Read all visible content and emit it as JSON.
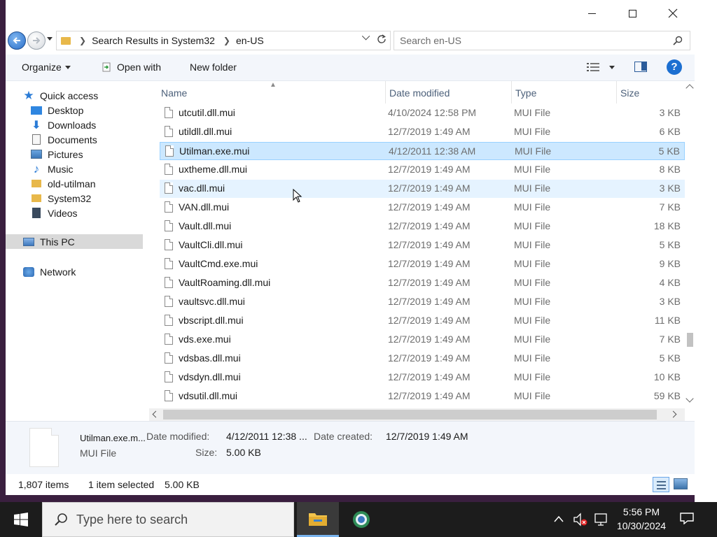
{
  "window": {
    "address": {
      "segments": [
        "Search Results in System32",
        "en-US"
      ]
    },
    "search": {
      "placeholder": "Search en-US"
    }
  },
  "toolbar": {
    "organize_label": "Organize",
    "open_with_label": "Open with",
    "new_folder_label": "New folder"
  },
  "nav": {
    "items": [
      {
        "label": "Quick access"
      },
      {
        "label": "Desktop"
      },
      {
        "label": "Downloads"
      },
      {
        "label": "Documents"
      },
      {
        "label": "Pictures"
      },
      {
        "label": "Music"
      },
      {
        "label": "old-utilman"
      },
      {
        "label": "System32"
      },
      {
        "label": "Videos"
      },
      {
        "label": "This PC"
      },
      {
        "label": "Network"
      }
    ]
  },
  "columns": {
    "name": "Name",
    "date": "Date modified",
    "type": "Type",
    "size": "Size"
  },
  "files": [
    {
      "name": "utcutil.dll.mui",
      "date": "4/10/2024 12:58 PM",
      "type": "MUI File",
      "size": "3 KB"
    },
    {
      "name": "utildll.dll.mui",
      "date": "12/7/2019 1:49 AM",
      "type": "MUI File",
      "size": "6 KB"
    },
    {
      "name": "Utilman.exe.mui",
      "date": "4/12/2011 12:38 AM",
      "type": "MUI File",
      "size": "5 KB"
    },
    {
      "name": "uxtheme.dll.mui",
      "date": "12/7/2019 1:49 AM",
      "type": "MUI File",
      "size": "8 KB"
    },
    {
      "name": "vac.dll.mui",
      "date": "12/7/2019 1:49 AM",
      "type": "MUI File",
      "size": "3 KB"
    },
    {
      "name": "VAN.dll.mui",
      "date": "12/7/2019 1:49 AM",
      "type": "MUI File",
      "size": "7 KB"
    },
    {
      "name": "Vault.dll.mui",
      "date": "12/7/2019 1:49 AM",
      "type": "MUI File",
      "size": "18 KB"
    },
    {
      "name": "VaultCli.dll.mui",
      "date": "12/7/2019 1:49 AM",
      "type": "MUI File",
      "size": "5 KB"
    },
    {
      "name": "VaultCmd.exe.mui",
      "date": "12/7/2019 1:49 AM",
      "type": "MUI File",
      "size": "9 KB"
    },
    {
      "name": "VaultRoaming.dll.mui",
      "date": "12/7/2019 1:49 AM",
      "type": "MUI File",
      "size": "4 KB"
    },
    {
      "name": "vaultsvc.dll.mui",
      "date": "12/7/2019 1:49 AM",
      "type": "MUI File",
      "size": "3 KB"
    },
    {
      "name": "vbscript.dll.mui",
      "date": "12/7/2019 1:49 AM",
      "type": "MUI File",
      "size": "11 KB"
    },
    {
      "name": "vds.exe.mui",
      "date": "12/7/2019 1:49 AM",
      "type": "MUI File",
      "size": "7 KB"
    },
    {
      "name": "vdsbas.dll.mui",
      "date": "12/7/2019 1:49 AM",
      "type": "MUI File",
      "size": "5 KB"
    },
    {
      "name": "vdsdyn.dll.mui",
      "date": "12/7/2019 1:49 AM",
      "type": "MUI File",
      "size": "10 KB"
    },
    {
      "name": "vdsutil.dll.mui",
      "date": "12/7/2019 1:49 AM",
      "type": "MUI File",
      "size": "59 KB"
    }
  ],
  "details": {
    "name": "Utilman.exe.m...",
    "type": "MUI File",
    "date_modified_label": "Date modified:",
    "date_modified": "4/12/2011 12:38 ...",
    "date_created_label": "Date created:",
    "date_created": "12/7/2019 1:49 AM",
    "size_label": "Size:",
    "size": "5.00 KB"
  },
  "status": {
    "items_count": "1,807 items",
    "selected": "1 item selected",
    "selected_size": "5.00 KB"
  },
  "taskbar": {
    "search_placeholder": "Type here to search",
    "time": "5:56 PM",
    "date": "10/30/2024"
  },
  "colors": {
    "selection": "#cce8ff",
    "accent": "#1c6fd1",
    "header_text": "#4c607a"
  }
}
